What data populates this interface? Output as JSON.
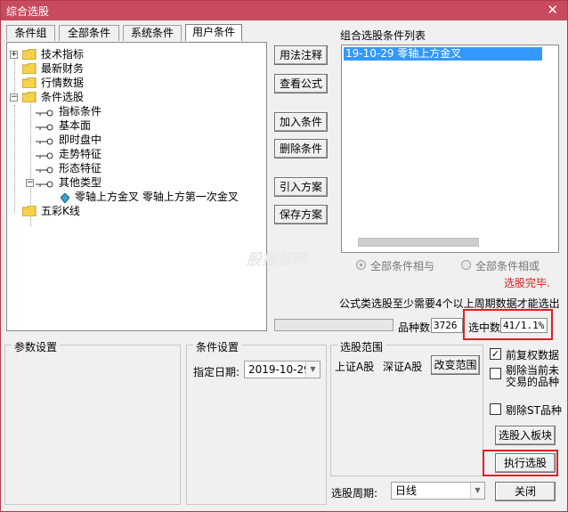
{
  "window": {
    "title": "综合选股",
    "close_glyph": "✕"
  },
  "tabs": [
    "条件组",
    "全部条件",
    "系统条件",
    "用户条件"
  ],
  "tree": {
    "items": [
      {
        "label": "技术指标",
        "icon": "folder-icon"
      },
      {
        "label": "最新财务",
        "icon": "folder-icon"
      },
      {
        "label": "行情数据",
        "icon": "folder-icon"
      },
      {
        "label": "条件选股",
        "icon": "folder-open-icon"
      },
      {
        "label": "指标条件",
        "icon": "key-icon"
      },
      {
        "label": "基本面",
        "icon": "key-icon"
      },
      {
        "label": "即时盘中",
        "icon": "key-icon"
      },
      {
        "label": "走势特征",
        "icon": "key-icon"
      },
      {
        "label": "形态特征",
        "icon": "key-icon"
      },
      {
        "label": "其他类型",
        "icon": "key-icon"
      },
      {
        "label": "零轴上方金叉  零轴上方第一次金叉",
        "icon": "diamond-icon"
      },
      {
        "label": "五彩K线",
        "icon": "folder-icon"
      }
    ]
  },
  "buttons": {
    "usage": "用法注释",
    "view_formula": "查看公式",
    "add_condition": "加入条件",
    "delete_condition": "删除条件",
    "import_plan": "引入方案",
    "save_plan": "保存方案",
    "change_range": "改变范围",
    "add_to_board": "选股入板块",
    "execute": "执行选股",
    "close": "关闭"
  },
  "condition_list": {
    "title": "组合选股条件列表",
    "items": [
      "19-10-29  零轴上方金叉"
    ]
  },
  "radios": {
    "all_and": "全部条件相与",
    "all_or": "全部条件相或",
    "selected": "all_and"
  },
  "status": {
    "done": "选股完毕.",
    "note": "公式类选股至少需要4个以上周期数据才能选出",
    "variety_label": "品种数",
    "variety_count": "3726",
    "selected_label": "选中数",
    "selected_value": "41/1.1%",
    "progress": 0
  },
  "params": {
    "title": "参数设置"
  },
  "condition_settings": {
    "title": "条件设置",
    "date_label": "指定日期:",
    "date_value": "2019-10-29"
  },
  "range": {
    "title": "选股范围",
    "sh": "上证A股",
    "sz": "深证A股"
  },
  "options": {
    "pre_adjust": {
      "label": "前复权数据",
      "checked": true
    },
    "exclude_halt": {
      "label": "剔除当前未交易的品种",
      "checked": false
    },
    "exclude_st": {
      "label": "剔除ST品种",
      "checked": false
    }
  },
  "period": {
    "label": "选股周期:",
    "value": "日线"
  },
  "colors": {
    "title_bar": "#c84a5e",
    "selection": "#3399ff",
    "status_red": "#e02020"
  }
}
